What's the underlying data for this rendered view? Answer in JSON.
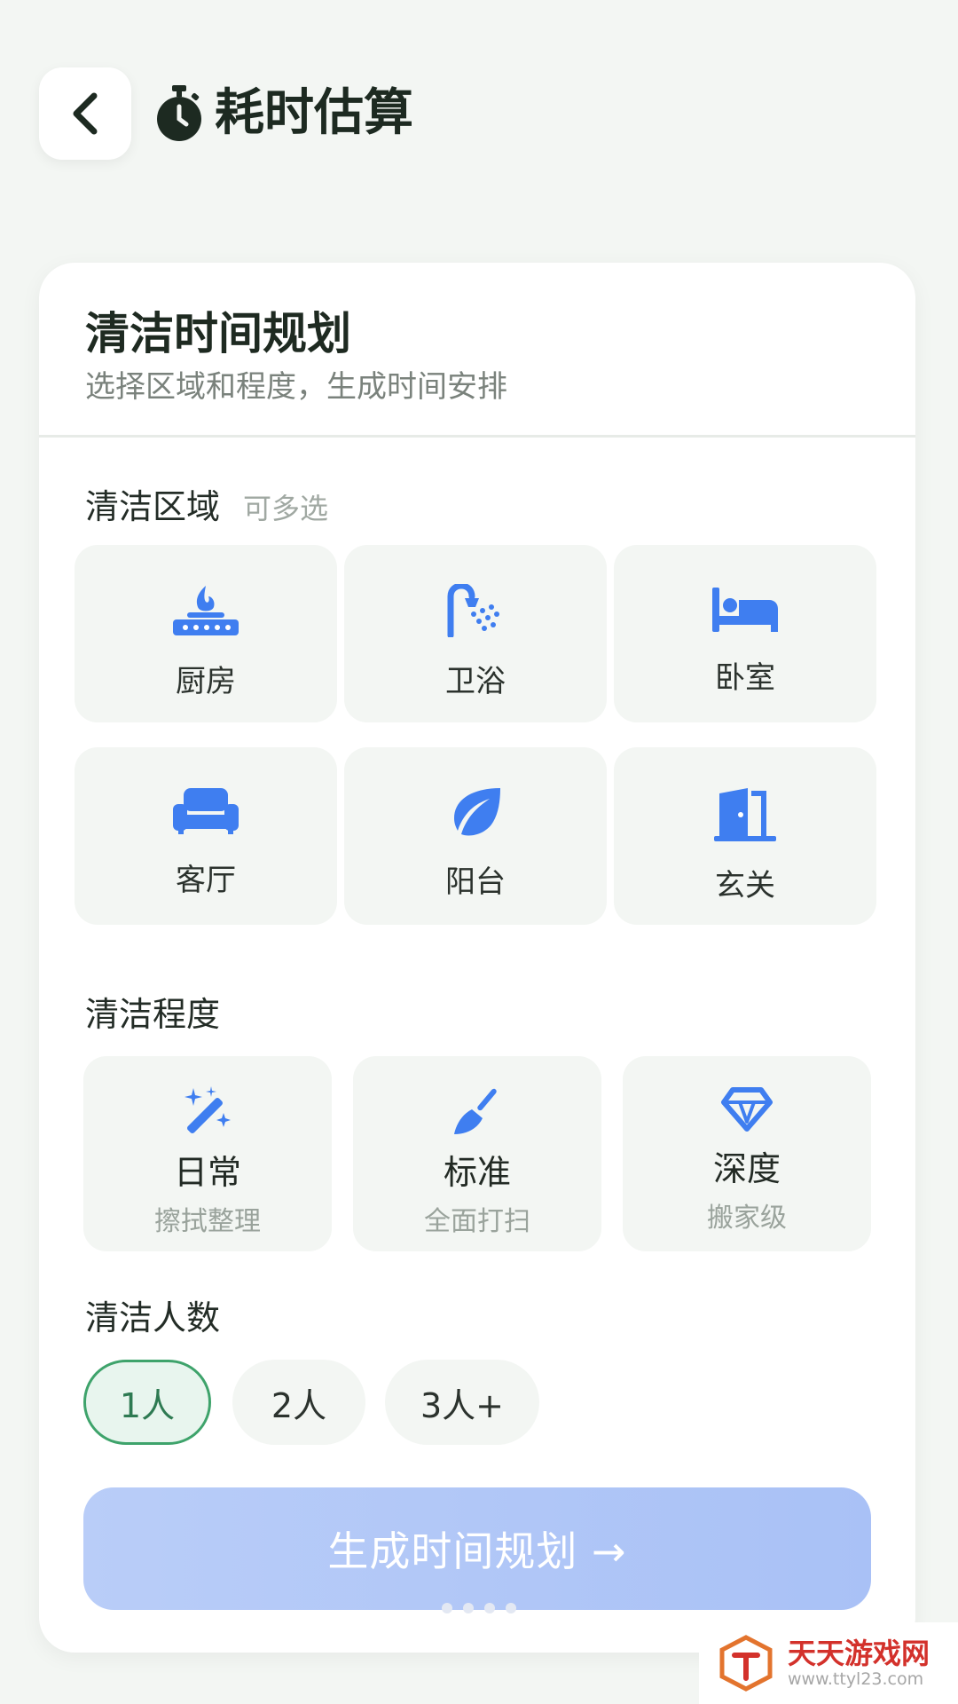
{
  "header": {
    "title": "耗时估算",
    "back_icon": "chevron-left-icon",
    "title_icon": "stopwatch-icon"
  },
  "card": {
    "title": "清洁时间规划",
    "subtitle": "选择区域和程度，生成时间安排"
  },
  "areas": {
    "label": "清洁区域",
    "hint": "可多选",
    "items": [
      {
        "label": "厨房",
        "icon": "stove-icon"
      },
      {
        "label": "卫浴",
        "icon": "shower-icon"
      },
      {
        "label": "卧室",
        "icon": "bed-icon"
      },
      {
        "label": "客厅",
        "icon": "sofa-icon"
      },
      {
        "label": "阳台",
        "icon": "leaf-icon"
      },
      {
        "label": "玄关",
        "icon": "door-icon"
      }
    ]
  },
  "levels": {
    "label": "清洁程度",
    "items": [
      {
        "name": "日常",
        "desc": "擦拭整理",
        "icon": "magic-wand-icon"
      },
      {
        "name": "标准",
        "desc": "全面打扫",
        "icon": "broom-icon"
      },
      {
        "name": "深度",
        "desc": "搬家级",
        "icon": "diamond-icon"
      }
    ]
  },
  "people": {
    "label": "清洁人数",
    "options": [
      "1人",
      "2人",
      "3人+"
    ],
    "selected": "1人"
  },
  "cta": {
    "label": "生成时间规划 →"
  },
  "watermark": {
    "title": "天天游戏网",
    "url": "www.ttyl23.com"
  },
  "colors": {
    "background": "#f3f6f3",
    "accent_green": "#3ea36b",
    "icon_blue": "#3f7ef0",
    "cta_blue": "#b9cdf8"
  }
}
